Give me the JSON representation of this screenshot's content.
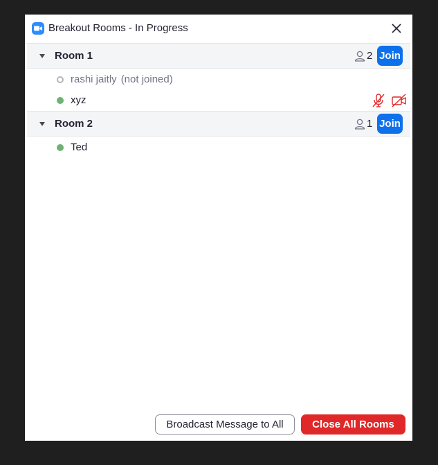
{
  "window": {
    "title": "Breakout Rooms - In Progress",
    "app_icon": "zoom-camera-icon",
    "close_icon": "close-icon"
  },
  "colors": {
    "accent": "#0e71eb",
    "danger": "#e02828",
    "joined_status": "#6db372",
    "not_joined_status": "#b5b5b8",
    "room_header_bg": "#f4f5f7"
  },
  "rooms": [
    {
      "name": "Room 1",
      "count": "2",
      "join_label": "Join",
      "expanded": true,
      "participants": [
        {
          "name": "rashi jaitly",
          "note": "(not joined)",
          "status": "not-joined",
          "muted": false,
          "video_off": false
        },
        {
          "name": "xyz",
          "note": "",
          "status": "joined",
          "muted": true,
          "video_off": true
        }
      ]
    },
    {
      "name": "Room 2",
      "count": "1",
      "join_label": "Join",
      "expanded": true,
      "participants": [
        {
          "name": "Ted",
          "note": "",
          "status": "joined",
          "muted": false,
          "video_off": false
        }
      ]
    }
  ],
  "footer": {
    "broadcast_label": "Broadcast Message to All",
    "close_all_label": "Close All Rooms"
  }
}
